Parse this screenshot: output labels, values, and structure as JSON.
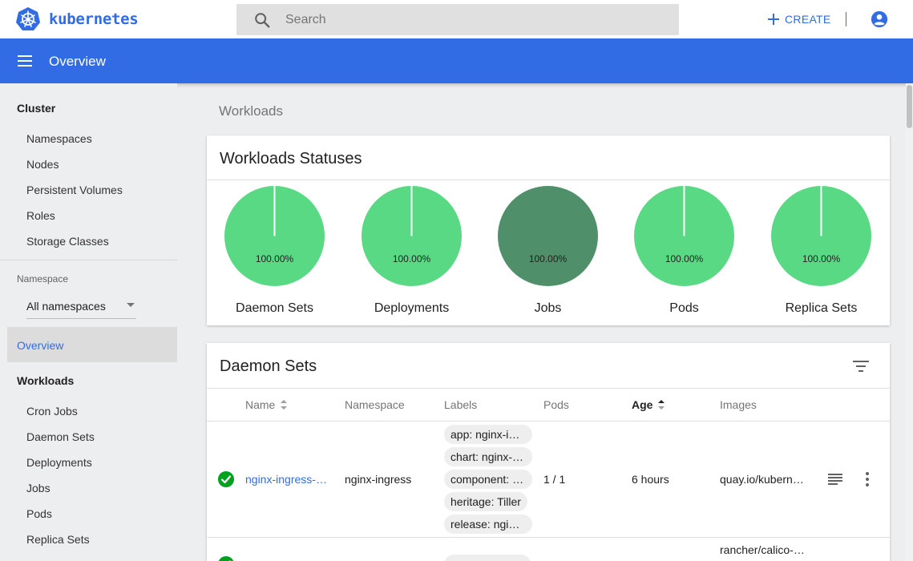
{
  "app": {
    "brand": "kubernetes",
    "search_placeholder": "Search",
    "create_label": "CREATE",
    "page_title": "Overview",
    "brand_color": "#326ce5"
  },
  "sidebar": {
    "cluster_heading": "Cluster",
    "cluster_items": [
      "Namespaces",
      "Nodes",
      "Persistent Volumes",
      "Roles",
      "Storage Classes"
    ],
    "namespace_label": "Namespace",
    "namespace_value": "All namespaces",
    "overview_label": "Overview",
    "workloads_heading": "Workloads",
    "workload_items": [
      "Cron Jobs",
      "Daemon Sets",
      "Deployments",
      "Jobs",
      "Pods",
      "Replica Sets"
    ]
  },
  "main": {
    "section_label": "Workloads",
    "statuses": {
      "title": "Workloads Statuses",
      "charts": [
        {
          "name": "Daemon Sets",
          "percent_label": "100.00%",
          "running_fraction": 1.0,
          "color": "#5ad984"
        },
        {
          "name": "Deployments",
          "percent_label": "100.00%",
          "running_fraction": 1.0,
          "color": "#5ad984"
        },
        {
          "name": "Jobs",
          "percent_label": "100.00%",
          "running_fraction": 1.0,
          "color": "#4f8f69"
        },
        {
          "name": "Pods",
          "percent_label": "100.00%",
          "running_fraction": 1.0,
          "color": "#5ad984"
        },
        {
          "name": "Replica Sets",
          "percent_label": "100.00%",
          "running_fraction": 1.0,
          "color": "#5ad984"
        }
      ]
    },
    "daemon_sets": {
      "title": "Daemon Sets",
      "columns": {
        "name": "Name",
        "namespace": "Namespace",
        "labels": "Labels",
        "pods": "Pods",
        "age": "Age",
        "images": "Images"
      },
      "rows": [
        {
          "name": "nginx-ingress-controller",
          "namespace": "nginx-ingress",
          "labels": [
            "app: nginx-ingress",
            "chart: nginx-ingress",
            "component: controller",
            "heritage: Tiller",
            "release: nginx-ingress"
          ],
          "pods": "1 / 1",
          "age": "6 hours",
          "images": "quay.io/kubernetes-ingress-controller",
          "status": "running"
        },
        {
          "images": "rancher/calico-node",
          "status": "running"
        }
      ]
    }
  }
}
